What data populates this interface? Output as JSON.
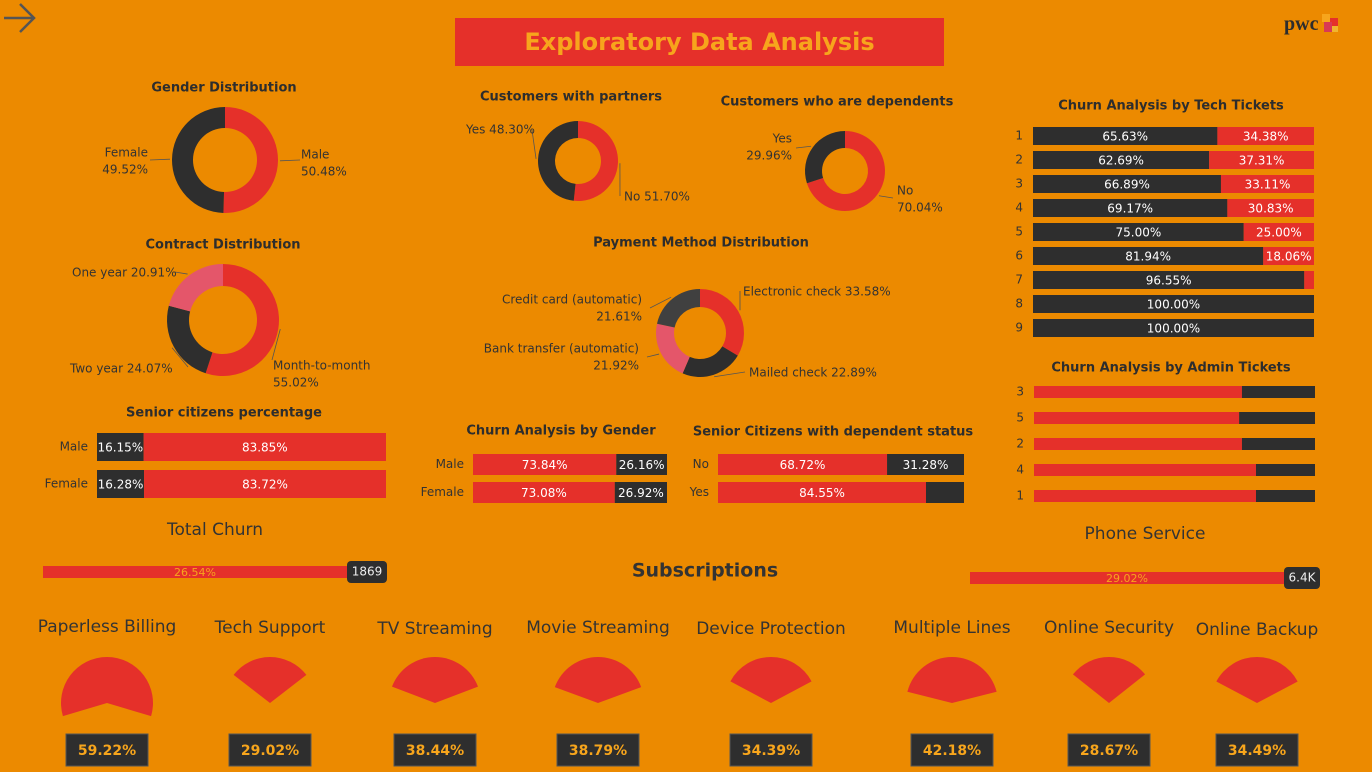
{
  "header": {
    "title": "Exploratory Data Analysis",
    "logo_text": "pwc",
    "back_icon": "arrow-right-icon"
  },
  "colors": {
    "background": "#ec8a00",
    "red": "#e5302a",
    "dark": "#2e2e2e",
    "pink": "#e4566a",
    "banner_text": "#f7a51c"
  },
  "chart_data": [
    {
      "id": "gender",
      "type": "pie",
      "title": "Gender Distribution",
      "slices": [
        {
          "label": "Male",
          "value": 50.48,
          "display": "50.48%",
          "color": "#e5302a"
        },
        {
          "label": "Female",
          "value": 49.52,
          "display": "49.52%",
          "color": "#2e2e2e"
        }
      ]
    },
    {
      "id": "contract",
      "type": "pie",
      "title": "Contract Distribution",
      "slices": [
        {
          "label": "Month-to-month",
          "value": 55.02,
          "display": "55.02%",
          "color": "#e5302a"
        },
        {
          "label": "Two year",
          "value": 24.07,
          "display": "24.07%",
          "color": "#2e2e2e"
        },
        {
          "label": "One year",
          "value": 20.91,
          "display": "20.91%",
          "color": "#e4566a"
        }
      ]
    },
    {
      "id": "partners",
      "type": "pie",
      "title": "Customers with partners",
      "slices": [
        {
          "label": "No",
          "value": 51.7,
          "display": "51.70%",
          "color": "#e5302a"
        },
        {
          "label": "Yes",
          "value": 48.3,
          "display": "48.30%",
          "color": "#2e2e2e"
        }
      ]
    },
    {
      "id": "dependents",
      "type": "pie",
      "title": "Customers who are dependents",
      "slices": [
        {
          "label": "No",
          "value": 70.04,
          "display": "70.04%",
          "color": "#e5302a"
        },
        {
          "label": "Yes",
          "value": 29.96,
          "display": "29.96%",
          "color": "#2e2e2e"
        }
      ]
    },
    {
      "id": "payment",
      "type": "pie",
      "title": "Payment Method Distribution",
      "slices": [
        {
          "label": "Electronic check",
          "value": 33.58,
          "display": "33.58%",
          "color": "#e5302a"
        },
        {
          "label": "Mailed check",
          "value": 22.89,
          "display": "22.89%",
          "color": "#2e2e2e"
        },
        {
          "label": "Bank transfer (automatic)",
          "value": 21.92,
          "display": "21.92%",
          "color": "#e4566a"
        },
        {
          "label": "Credit card (automatic)",
          "value": 21.61,
          "display": "21.61%",
          "color": "#404040"
        }
      ]
    },
    {
      "id": "senior",
      "type": "bar",
      "title": "Senior citizens percentage",
      "categories": [
        "Male",
        "Female"
      ],
      "series": [
        {
          "values": [
            16.15,
            16.28
          ],
          "labels": [
            "16.15%",
            "16.28%"
          ],
          "color": "#2e2e2e"
        },
        {
          "values": [
            83.85,
            83.72
          ],
          "labels": [
            "83.85%",
            "83.72%"
          ],
          "color": "#e5302a"
        }
      ]
    },
    {
      "id": "churn_gender",
      "type": "bar",
      "title": "Churn Analysis by Gender",
      "categories": [
        "Male",
        "Female"
      ],
      "series": [
        {
          "values": [
            73.84,
            73.08
          ],
          "labels": [
            "73.84%",
            "73.08%"
          ],
          "color": "#e5302a"
        },
        {
          "values": [
            26.16,
            26.92
          ],
          "labels": [
            "26.16%",
            "26.92%"
          ],
          "color": "#2e2e2e"
        }
      ]
    },
    {
      "id": "senior_dependent",
      "type": "bar",
      "title": "Senior Citizens with dependent status",
      "categories": [
        "No",
        "Yes"
      ],
      "series": [
        {
          "values": [
            68.72,
            84.55
          ],
          "labels": [
            "68.72%",
            "84.55%"
          ],
          "color": "#e5302a"
        },
        {
          "values": [
            31.28,
            15.45
          ],
          "labels": [
            "31.28%",
            ""
          ],
          "color": "#2e2e2e"
        }
      ]
    },
    {
      "id": "tech_tickets",
      "type": "bar",
      "title": "Churn Analysis by Tech Tickets",
      "categories": [
        "1",
        "2",
        "3",
        "4",
        "5",
        "6",
        "7",
        "8",
        "9"
      ],
      "series": [
        {
          "values": [
            65.63,
            62.69,
            66.89,
            69.17,
            75.0,
            81.94,
            96.55,
            100.0,
            100.0
          ],
          "labels": [
            "65.63%",
            "62.69%",
            "66.89%",
            "69.17%",
            "75.00%",
            "81.94%",
            "96.55%",
            "100.00%",
            "100.00%"
          ],
          "color": "#2e2e2e"
        },
        {
          "values": [
            34.38,
            37.31,
            33.11,
            30.83,
            25.0,
            18.06,
            3.45,
            0,
            0
          ],
          "labels": [
            "34.38%",
            "37.31%",
            "33.11%",
            "30.83%",
            "25.00%",
            "18.06%",
            "",
            "",
            ""
          ],
          "color": "#e5302a"
        }
      ]
    },
    {
      "id": "admin_tickets",
      "type": "bar",
      "title": "Churn Analysis by Admin Tickets",
      "categories": [
        "3",
        "5",
        "2",
        "4",
        "1"
      ],
      "series": [
        {
          "values": [
            74,
            73,
            74,
            79,
            79
          ],
          "color": "#e5302a"
        },
        {
          "values": [
            26,
            27,
            26,
            21,
            21
          ],
          "color": "#2e2e2e"
        }
      ]
    },
    {
      "id": "total_churn",
      "type": "bar",
      "title": "Total Churn",
      "value": 26.54,
      "value_label": "26.54%",
      "target_label": "1869"
    },
    {
      "id": "phone_service",
      "type": "bar",
      "title": "Phone Service",
      "value": 29.02,
      "value_label": "29.02%",
      "target_label": "6.4K"
    },
    {
      "id": "subscriptions",
      "type": "pie",
      "title": "Subscriptions",
      "items": [
        {
          "label": "Paperless Billing",
          "value": 59.22,
          "display": "59.22%"
        },
        {
          "label": "Tech Support",
          "value": 29.02,
          "display": "29.02%"
        },
        {
          "label": "TV Streaming",
          "value": 38.44,
          "display": "38.44%"
        },
        {
          "label": "Movie Streaming",
          "value": 38.79,
          "display": "38.79%"
        },
        {
          "label": "Device Protection",
          "value": 34.39,
          "display": "34.39%"
        },
        {
          "label": "Multiple Lines",
          "value": 42.18,
          "display": "42.18%"
        },
        {
          "label": "Online Security",
          "value": 28.67,
          "display": "28.67%"
        },
        {
          "label": "Online Backup",
          "value": 34.49,
          "display": "34.49%"
        }
      ]
    }
  ]
}
